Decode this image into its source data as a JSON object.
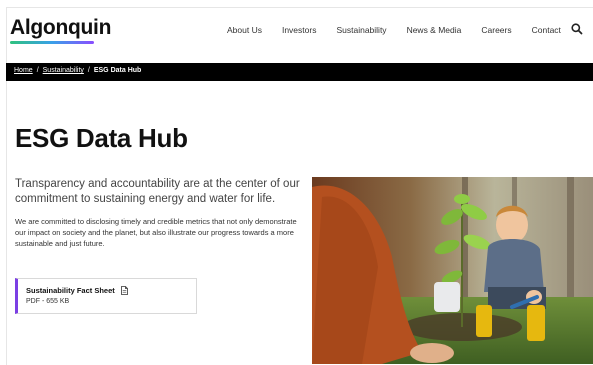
{
  "header": {
    "logo_text": "Algonquin",
    "nav": [
      "About Us",
      "Investors",
      "Sustainability",
      "News & Media",
      "Careers",
      "Contact"
    ],
    "search_icon": "search-icon"
  },
  "breadcrumb": {
    "items": [
      "Home",
      "Sustainability"
    ],
    "separator": "/",
    "current": "ESG Data Hub"
  },
  "main": {
    "title": "ESG Data Hub",
    "lead": "Transparency and accountability are at the center of our commitment to sustaining energy and water for life.",
    "body": "We are committed to disclosing timely and credible metrics that not only demonstrate our impact on society and the planet, but also illustrate our progress towards a more sustainable and just future.",
    "card": {
      "title": "Sustainability Fact Sheet",
      "meta": "PDF - 655 KB",
      "icon": "document-icon"
    }
  },
  "colors": {
    "accent": "#7b3fe4",
    "breadcrumb_bg": "#000000"
  }
}
